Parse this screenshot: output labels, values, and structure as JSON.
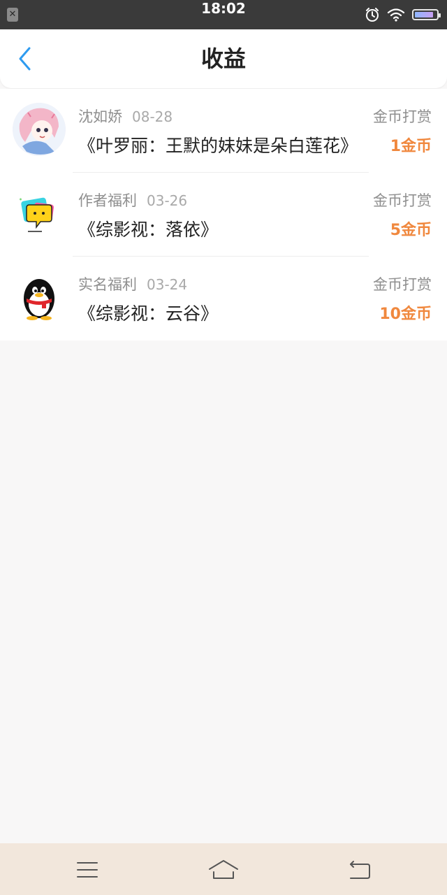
{
  "status_bar": {
    "time": "18:02",
    "left_icon_glyph": "✕",
    "battery_level": 0.85,
    "icons": [
      "sim-off-icon",
      "alarm-icon",
      "wifi-icon",
      "battery-icon"
    ]
  },
  "header": {
    "title": "收益",
    "back_icon": "chevron-left-icon",
    "accent_color": "#2e9bf0"
  },
  "earnings": [
    {
      "name": "沈如娇",
      "date": "08-28",
      "title": "《叶罗丽：王默的妹妹是朵白莲花》",
      "type": "金币打赏",
      "amount": "1金币",
      "avatar": "anime-girl-avatar"
    },
    {
      "name": "作者福利",
      "date": "03-26",
      "title": "《综影视：落依》",
      "type": "金币打赏",
      "amount": "5金币",
      "avatar": "yellow-chat-bubble-avatar"
    },
    {
      "name": "实名福利",
      "date": "03-24",
      "title": "《综影视：云谷》",
      "type": "金币打赏",
      "amount": "10金币",
      "avatar": "penguin-avatar"
    }
  ],
  "colors": {
    "amount": "#f0883e",
    "navbar_bg": "#f2e7dc",
    "page_bg": "#f8f7f7"
  },
  "nav_bar": {
    "icons": [
      "menu-icon",
      "home-icon",
      "back-icon"
    ]
  }
}
